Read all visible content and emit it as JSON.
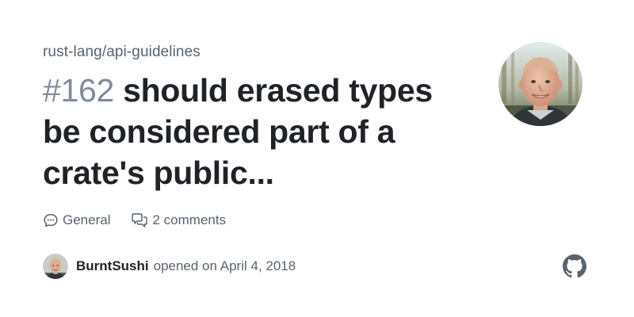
{
  "repo": {
    "name": "rust-lang/api-guidelines"
  },
  "issue": {
    "number": "#162",
    "title": "should erased types be considered part of a crate's public..."
  },
  "meta": {
    "category_icon": "comment-icon",
    "category": "General",
    "comments_icon": "comments-icon",
    "comments": "2 comments"
  },
  "author": {
    "name": "BurntSushi",
    "opened_text": "opened on April 4, 2018"
  },
  "brand": {
    "icon": "github-icon",
    "color": "#59636e"
  }
}
